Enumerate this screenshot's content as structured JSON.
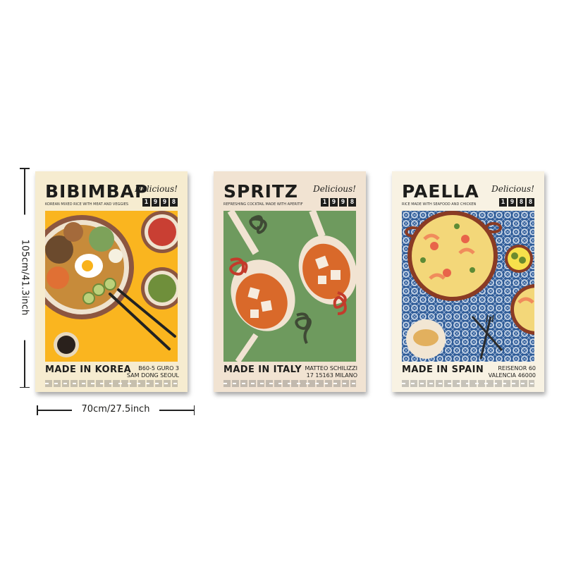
{
  "dimensions": {
    "height_label": "105cm/41.3inch",
    "width_label": "70cm/27.5inch"
  },
  "posters": [
    {
      "title": "BIBIMBAP",
      "tag": "Delicious!",
      "year": "1998",
      "subtitle": "KOREAN MIXED RICE WITH MEAT AND VEGGIES",
      "made": "MADE IN KOREA",
      "address_line1": "B60-5 GURO 3",
      "address_line2": "SAM DONG SEOUL",
      "colors": {
        "background": "#fab51f",
        "paper": "#f6ecd0"
      }
    },
    {
      "title": "SPRITZ",
      "tag": "Delicious!",
      "year": "1998",
      "subtitle": "REFRESHING COCKTAIL MADE WITH APERITIF",
      "made": "MADE IN ITALY",
      "address_line1": "MATTEO SCHILIZZI",
      "address_line2": "17 15163 MILANO",
      "colors": {
        "background": "#6e9a5e",
        "paper": "#f1e3d2"
      }
    },
    {
      "title": "PAELLA",
      "tag": "Delicious!",
      "year": "1988",
      "subtitle": "RICE MADE WITH SEAFOOD AND CHICKEN",
      "made": "MADE IN SPAIN",
      "address_line1": "REISENOR 60",
      "address_line2": "VALENCIA 46000",
      "colors": {
        "background": "#2f5c98",
        "paper": "#f8f2e3"
      }
    }
  ]
}
